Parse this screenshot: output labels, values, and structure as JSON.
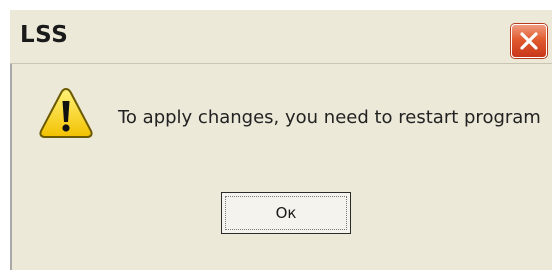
{
  "window": {
    "title": "LSS"
  },
  "titlebar_buttons": {
    "close_icon": "close-icon"
  },
  "message": {
    "text": "To apply changes, you need to restart program",
    "icon": "warning-icon"
  },
  "buttons": {
    "ok_label": "Ок"
  },
  "colors": {
    "dialog_bg": "#ece9d8",
    "close_red": "#e15b2f",
    "warning_yellow": "#f5d21a"
  }
}
